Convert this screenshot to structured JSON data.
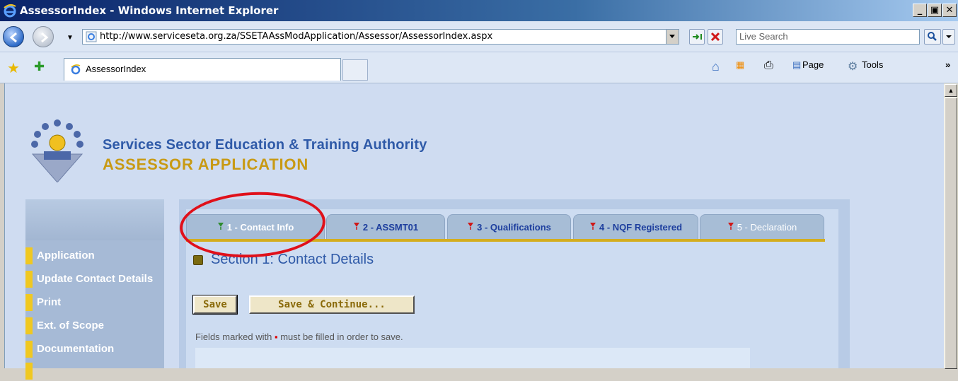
{
  "window": {
    "title": "AssessorIndex - Windows Internet Explorer",
    "minimize": "_",
    "maximize": "▣",
    "close": "✕"
  },
  "addressbar": {
    "url": "http://www.serviceseta.org.za/SSETAAssModApplication/Assessor/AssessorIndex.aspx",
    "search_placeholder": "Live Search"
  },
  "tabs": {
    "active_tab_label": "AssessorIndex"
  },
  "command_bar": {
    "page_label": "Page",
    "tools_label": "Tools",
    "more": "»"
  },
  "site": {
    "org_name": "Services Sector Education & Training Authority",
    "app_name": "ASSESSOR APPLICATION"
  },
  "leftnav": {
    "items": [
      {
        "label": "Application"
      },
      {
        "label": "Update Contact Details"
      },
      {
        "label": "Print"
      },
      {
        "label": "Ext. of Scope"
      },
      {
        "label": "Documentation"
      }
    ]
  },
  "content_tabs": [
    {
      "label": "1 - Contact Info",
      "state": "active",
      "flag_color": "#2e8b2e"
    },
    {
      "label": "2 - ASSMT01",
      "state": "link",
      "flag_color": "#d01818"
    },
    {
      "label": "3 - Qualifications",
      "state": "link",
      "flag_color": "#d01818"
    },
    {
      "label": "4 - NQF Registered",
      "state": "link",
      "flag_color": "#d01818"
    },
    {
      "label": "5 - Declaration",
      "state": "disabled",
      "flag_color": "#d01818"
    }
  ],
  "section": {
    "title": "Section 1: Contact Details"
  },
  "buttons": {
    "save": "Save",
    "save_continue": "Save & Continue..."
  },
  "note": {
    "before": "Fields marked with ",
    "marker": "▪",
    "after": " must be filled in order to save."
  },
  "colors": {
    "accent_blue": "#2f5aa8",
    "accent_gold": "#c89a14",
    "nav_bar": "#f0c820",
    "highlight_circle": "#e0101a"
  }
}
